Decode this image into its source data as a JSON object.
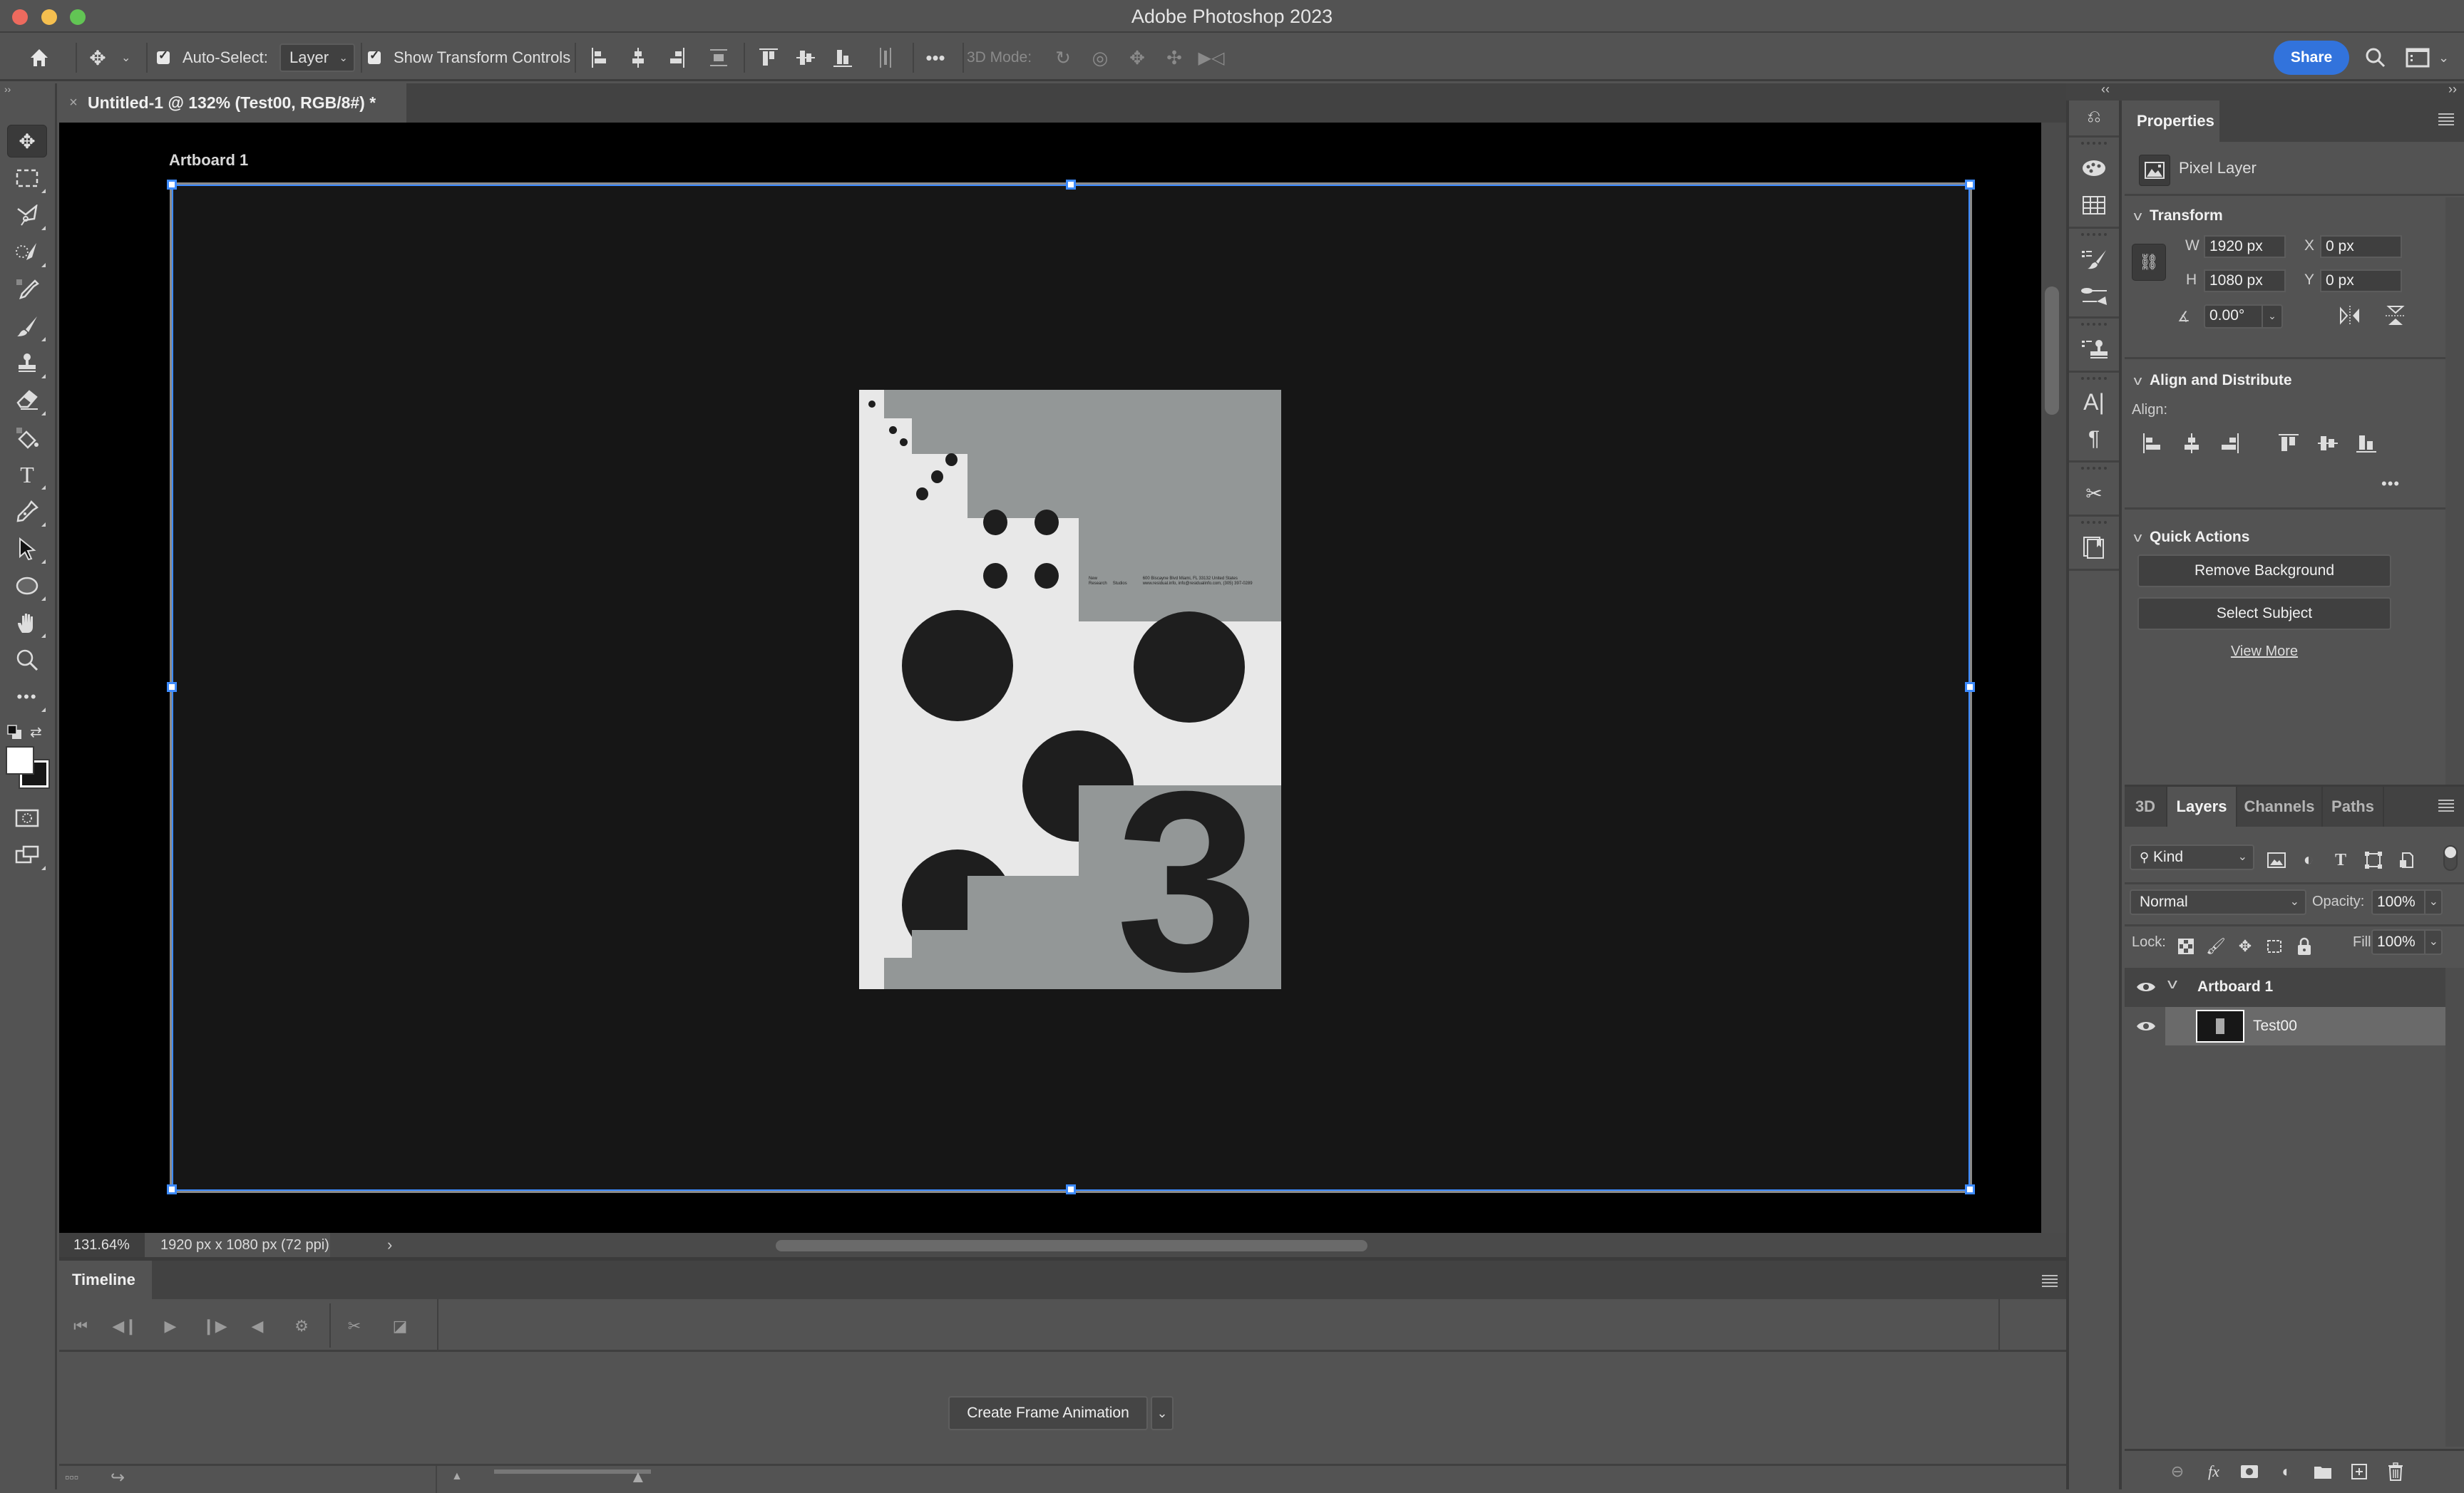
{
  "app": {
    "title": "Adobe Photoshop 2023"
  },
  "options_bar": {
    "auto_select_label": "Auto-Select:",
    "auto_select_checked": true,
    "auto_select_value": "Layer",
    "show_transform_label": "Show Transform Controls",
    "show_transform_checked": true,
    "mode_3d_label": "3D Mode:",
    "share_label": "Share",
    "more_icon": "ellipsis"
  },
  "document": {
    "tab_label": "Untitled-1 @ 132% (Test00, RGB/8#) *",
    "artboard_label": "Artboard 1",
    "zoom": "131.64%",
    "dimensions": "1920 px x 1080 px (72 ppi)"
  },
  "poster": {
    "number": "3",
    "info_col1": [
      "New",
      "Research"
    ],
    "info_col2": "Studios",
    "info_address": "600 Biscayne Blvd Miami, FL 33132 United States",
    "info_contact": "www.residual.info, info@residualinfo.com, (305) 397-0289",
    "colors": {
      "paper": "#e8e8e8",
      "gray": "#939797",
      "ink": "#1e1e1e"
    }
  },
  "tools": [
    {
      "name": "move-tool",
      "glyph": "✥",
      "active": true
    },
    {
      "name": "marquee-tool",
      "glyph": "⬚"
    },
    {
      "name": "lasso-tool",
      "glyph": "➶"
    },
    {
      "name": "quick-selection-tool",
      "glyph": "◌"
    },
    {
      "name": "eyedropper-tool",
      "glyph": "⚲"
    },
    {
      "name": "brush-tool",
      "glyph": "🖌"
    },
    {
      "name": "clone-stamp-tool",
      "glyph": "⊥"
    },
    {
      "name": "eraser-tool",
      "glyph": "⌫"
    },
    {
      "name": "paint-bucket-tool",
      "glyph": "⛋"
    },
    {
      "name": "type-tool",
      "glyph": "T"
    },
    {
      "name": "pen-tool",
      "glyph": "✒"
    },
    {
      "name": "path-selection-tool",
      "glyph": "➤"
    },
    {
      "name": "ellipse-tool",
      "glyph": "⬭"
    },
    {
      "name": "hand-tool",
      "glyph": "✋"
    },
    {
      "name": "zoom-tool",
      "glyph": "⚲"
    },
    {
      "name": "edit-toolbar",
      "glyph": "•••"
    }
  ],
  "colors": {
    "foreground": "#ffffff",
    "background": "#161616",
    "accent": "#3273dc",
    "selection": "#3d8bff"
  },
  "timeline": {
    "tab_label": "Timeline",
    "create_button_label": "Create Frame Animation",
    "dropdown_glyph": "⌄"
  },
  "properties": {
    "tab_label": "Properties",
    "layer_type": "Pixel Layer",
    "transform": {
      "section_label": "Transform",
      "w_label": "W",
      "w_value": "1920 px",
      "h_label": "H",
      "h_value": "1080 px",
      "x_label": "X",
      "x_value": "0 px",
      "y_label": "Y",
      "y_value": "0 px",
      "angle_value": "0.00°"
    },
    "align": {
      "section_label": "Align and Distribute",
      "align_label": "Align:"
    },
    "quick_actions": {
      "section_label": "Quick Actions",
      "remove_bg_label": "Remove Background",
      "select_subject_label": "Select Subject",
      "view_more_label": "View More"
    }
  },
  "layers_panel": {
    "tabs": [
      {
        "label": "3D",
        "active": false
      },
      {
        "label": "Layers",
        "active": true
      },
      {
        "label": "Channels",
        "active": false
      },
      {
        "label": "Paths",
        "active": false
      }
    ],
    "filter_kind": "Kind",
    "blend_mode": "Normal",
    "opacity_label": "Opacity:",
    "opacity_value": "100%",
    "lock_label": "Lock:",
    "fill_label": "Fill:",
    "fill_value": "100%",
    "layers": [
      {
        "name": "Artboard 1",
        "type": "artboard",
        "visible": true,
        "expanded": true
      },
      {
        "name": "Test00",
        "type": "pixel",
        "visible": true,
        "selected": true
      }
    ]
  }
}
